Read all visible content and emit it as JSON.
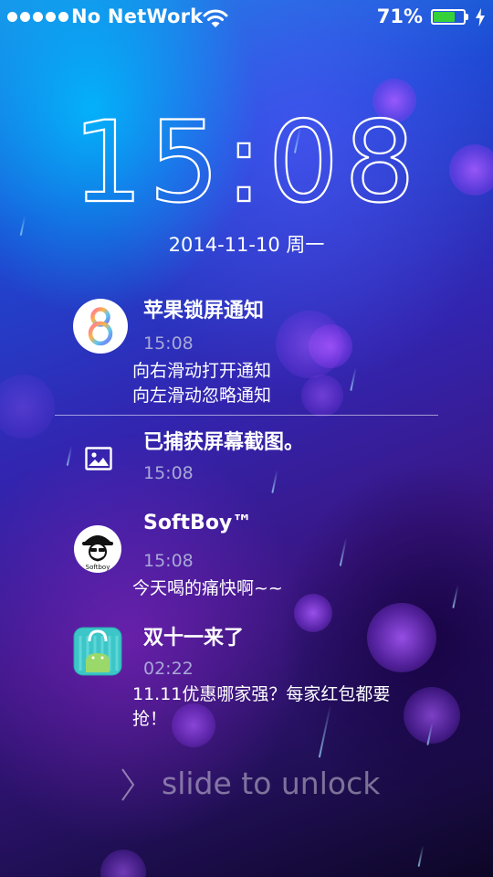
{
  "status_bar": {
    "carrier": "No NetWork",
    "battery_percent": "71%",
    "battery_level": 0.71,
    "charging": true,
    "signal_dots": 5
  },
  "lock_screen": {
    "time": "15:08",
    "date": "2014-11-10 周一",
    "slide_to_unlock": "slide to unlock"
  },
  "notifications": [
    {
      "icon": "ios8-icon",
      "title": "苹果锁屏通知",
      "time": "15:08",
      "body_lines": [
        "向右滑动打开通知",
        "向左滑动忽略通知"
      ]
    },
    {
      "icon": "image-icon",
      "title": "已捕获屏幕截图。",
      "time": "15:08",
      "body_lines": []
    },
    {
      "icon": "softboy-avatar-icon",
      "icon_text": "Softboy",
      "title": "SoftBoy™",
      "time": "15:08",
      "body_lines": [
        "今天喝的痛快啊~~"
      ]
    },
    {
      "icon": "android-shopping-bag-icon",
      "title": "双十一来了",
      "time": "02:22",
      "body_lines": [
        "11.11优惠哪家强？每家红包都要",
        "抢！"
      ]
    }
  ],
  "colors": {
    "battery_fill": "#35d13a",
    "time_muted": "#a8a8d8",
    "bag_teal": "#3cc6c8"
  }
}
